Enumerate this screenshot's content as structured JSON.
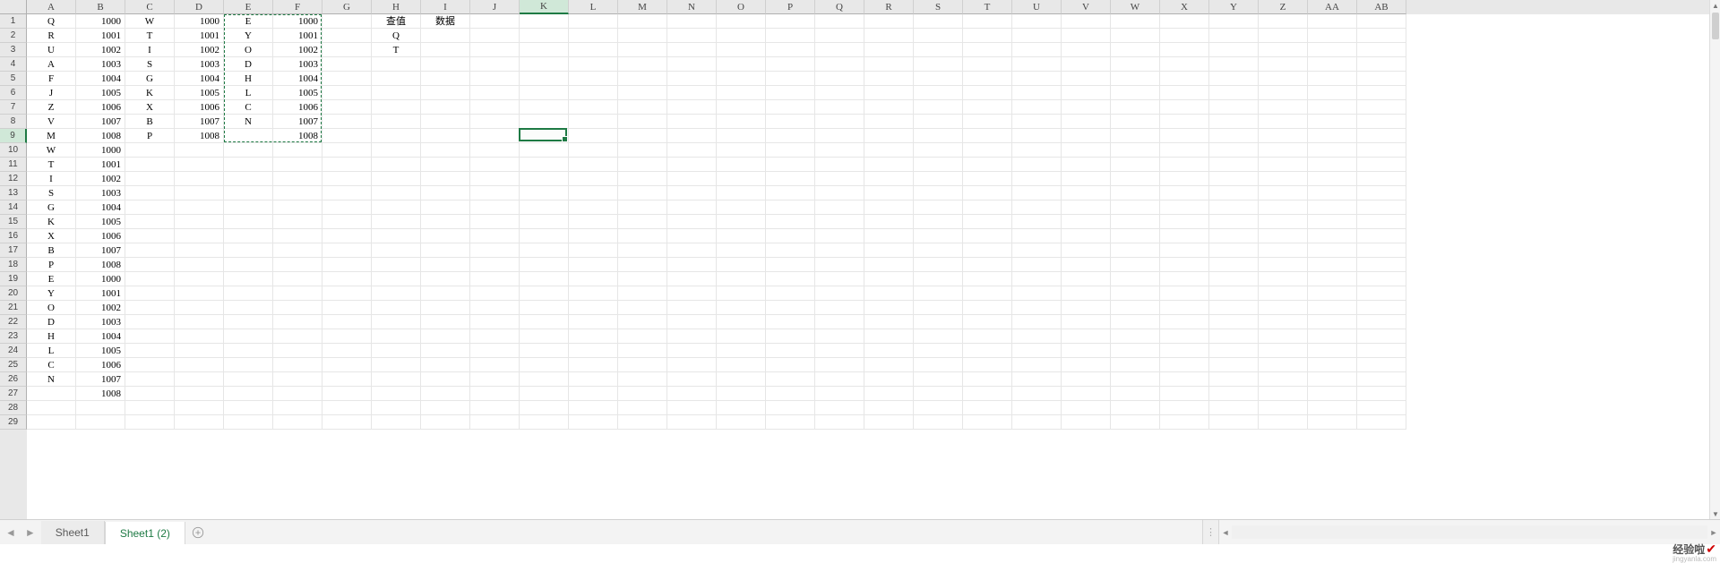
{
  "columns": [
    "A",
    "B",
    "C",
    "D",
    "E",
    "F",
    "G",
    "H",
    "I",
    "J",
    "K",
    "L",
    "M",
    "N",
    "O",
    "P",
    "Q",
    "R",
    "S",
    "T",
    "U",
    "V",
    "W",
    "X",
    "Y",
    "Z",
    "AA",
    "AB"
  ],
  "row_count": 29,
  "active_cell": {
    "col_index": 10,
    "row_index": 8
  },
  "marching_ants": {
    "col_start": 4,
    "row_start": 0,
    "col_end": 5,
    "row_end": 8
  },
  "cells": {
    "A": [
      "Q",
      "R",
      "U",
      "A",
      "F",
      "J",
      "Z",
      "V",
      "M",
      "W",
      "T",
      "I",
      "S",
      "G",
      "K",
      "X",
      "B",
      "P",
      "E",
      "Y",
      "O",
      "D",
      "H",
      "L",
      "C",
      "N",
      "",
      ""
    ],
    "B": [
      "1000",
      "1001",
      "1002",
      "1003",
      "1004",
      "1005",
      "1006",
      "1007",
      "1008",
      "1000",
      "1001",
      "1002",
      "1003",
      "1004",
      "1005",
      "1006",
      "1007",
      "1008",
      "1000",
      "1001",
      "1002",
      "1003",
      "1004",
      "1005",
      "1006",
      "1007",
      "1008",
      ""
    ],
    "C": [
      "W",
      "T",
      "I",
      "S",
      "G",
      "K",
      "X",
      "B",
      "P"
    ],
    "D": [
      "1000",
      "1001",
      "1002",
      "1003",
      "1004",
      "1005",
      "1006",
      "1007",
      "1008"
    ],
    "E": [
      "E",
      "Y",
      "O",
      "D",
      "H",
      "L",
      "C",
      "N",
      ""
    ],
    "F": [
      "1000",
      "1001",
      "1002",
      "1003",
      "1004",
      "1005",
      "1006",
      "1007",
      "1008"
    ],
    "H": [
      "查值",
      "Q",
      "T"
    ],
    "I": [
      "数据"
    ]
  },
  "numeric_columns": [
    "B",
    "D",
    "F"
  ],
  "tabs": {
    "items": [
      "Sheet1",
      "Sheet1 (2)"
    ],
    "active_index": 1
  },
  "watermark": {
    "brand": "经验啦",
    "domain": "jingyanla.com"
  },
  "chart_data": {
    "type": "table",
    "title": "",
    "columns": [
      "A",
      "B",
      "C",
      "D",
      "E",
      "F",
      "G",
      "H",
      "I"
    ],
    "rows": [
      [
        "Q",
        1000,
        "W",
        1000,
        "E",
        1000,
        "",
        "查值",
        "数据"
      ],
      [
        "R",
        1001,
        "T",
        1001,
        "Y",
        1001,
        "",
        "Q",
        ""
      ],
      [
        "U",
        1002,
        "I",
        1002,
        "O",
        1002,
        "",
        "T",
        ""
      ],
      [
        "A",
        1003,
        "S",
        1003,
        "D",
        1003,
        "",
        "",
        ""
      ],
      [
        "F",
        1004,
        "G",
        1004,
        "H",
        1004,
        "",
        "",
        ""
      ],
      [
        "J",
        1005,
        "K",
        1005,
        "L",
        1005,
        "",
        "",
        ""
      ],
      [
        "Z",
        1006,
        "X",
        1006,
        "C",
        1006,
        "",
        "",
        ""
      ],
      [
        "V",
        1007,
        "B",
        1007,
        "N",
        1007,
        "",
        "",
        ""
      ],
      [
        "M",
        1008,
        "P",
        1008,
        "",
        1008,
        "",
        "",
        ""
      ],
      [
        "W",
        1000,
        "",
        "",
        "",
        "",
        "",
        "",
        ""
      ],
      [
        "T",
        1001,
        "",
        "",
        "",
        "",
        "",
        "",
        ""
      ],
      [
        "I",
        1002,
        "",
        "",
        "",
        "",
        "",
        "",
        ""
      ],
      [
        "S",
        1003,
        "",
        "",
        "",
        "",
        "",
        "",
        ""
      ],
      [
        "G",
        1004,
        "",
        "",
        "",
        "",
        "",
        "",
        ""
      ],
      [
        "K",
        1005,
        "",
        "",
        "",
        "",
        "",
        "",
        ""
      ],
      [
        "X",
        1006,
        "",
        "",
        "",
        "",
        "",
        "",
        ""
      ],
      [
        "B",
        1007,
        "",
        "",
        "",
        "",
        "",
        "",
        ""
      ],
      [
        "P",
        1008,
        "",
        "",
        "",
        "",
        "",
        "",
        ""
      ],
      [
        "E",
        1000,
        "",
        "",
        "",
        "",
        "",
        "",
        ""
      ],
      [
        "Y",
        1001,
        "",
        "",
        "",
        "",
        "",
        "",
        ""
      ],
      [
        "O",
        1002,
        "",
        "",
        "",
        "",
        "",
        "",
        ""
      ],
      [
        "D",
        1003,
        "",
        "",
        "",
        "",
        "",
        "",
        ""
      ],
      [
        "H",
        1004,
        "",
        "",
        "",
        "",
        "",
        "",
        ""
      ],
      [
        "L",
        1005,
        "",
        "",
        "",
        "",
        "",
        "",
        ""
      ],
      [
        "C",
        1006,
        "",
        "",
        "",
        "",
        "",
        "",
        ""
      ],
      [
        "N",
        1007,
        "",
        "",
        "",
        "",
        "",
        "",
        ""
      ],
      [
        "",
        1008,
        "",
        "",
        "",
        "",
        "",
        "",
        ""
      ]
    ]
  }
}
